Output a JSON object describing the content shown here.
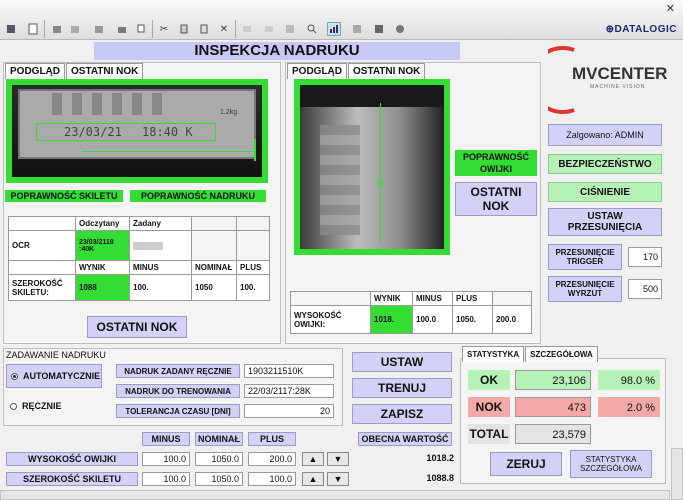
{
  "toolbar": {
    "brand": "DATALOGIC",
    "close_glyph": "✕",
    "icons": [
      "stop-icon",
      "document-icon",
      "save-icon",
      "open-icon",
      "folder-icon",
      "print-icon",
      "cut-icon",
      "copy-icon",
      "paste-icon",
      "delete-icon",
      "undo-icon",
      "redo-icon",
      "zoom-icon",
      "chart-icon",
      "find-icon",
      "stop-square-icon",
      "record-icon"
    ]
  },
  "title": "INSPEKCJA NADRUKU",
  "logo": {
    "text": "MVCENTER",
    "subtitle": "MACHINE VISION"
  },
  "left_panel": {
    "tabs": [
      "PODGLĄD",
      "OSTATNI NOK"
    ],
    "camera_text_1": "23/03/21",
    "camera_text_2": "18:40 K",
    "camera_corner": "1.2kg",
    "status_skeleton": "POPRAWNOŚĆ SKILETU",
    "status_print": "POPRAWNOŚĆ NADRUKU",
    "ocr_table": {
      "header": [
        "",
        "Odczytany",
        "Zadany"
      ],
      "ocr_label": "OCR",
      "ocr_read": "23/03/2118 :40K",
      "width_header": [
        "",
        "WYNIK",
        "MINUS",
        "NOMINAŁ",
        "PLUS"
      ],
      "width_label": "SZEROKOŚĆ SKILETU:",
      "width_values": [
        "1088",
        "100.",
        "1050",
        "100."
      ]
    },
    "last_nok_button": "OSTATNI NOK"
  },
  "mid_panel": {
    "tabs": [
      "PODGLĄD",
      "OSTATNI NOK"
    ],
    "status_wrap": "POPRAWNOŚĆ OWIJKI",
    "last_nok_button": "OSTATNI NOK",
    "height_table": {
      "header": [
        "",
        "WYNIK",
        "MINUS",
        "PLUS",
        ""
      ],
      "label": "WYSOKOŚĆ OWIJKI:",
      "values": [
        "1018.",
        "100.0",
        "1050.",
        "200.0"
      ]
    }
  },
  "right_panel": {
    "logged": "Zalgowano: ADMIN",
    "security": "BEZPIECZEŃSTWO",
    "pressure": "CIŚNIENIE",
    "set_delay": "USTAW PRZESUNIĘCIA",
    "trigger_label": "PRZESUNIĘCIE TRIGGER",
    "trigger_value": "170",
    "eject_label": "PRZESUNIĘCIE WYRZUT",
    "eject_value": "500"
  },
  "print_setup": {
    "title": "ZADAWANIE NADRUKU",
    "auto": "AUTOMATYCZNIE",
    "manual": "RĘCZNIE",
    "manual_label": "NADRUK ZADANY RĘCZNIE",
    "manual_value": "1903211510K",
    "train_label": "NADRUK DO TRENOWANIA",
    "train_value": "22/03/2117:28K",
    "tol_label": "TOLERANCJA CZASU [DNI]",
    "tol_value": "20"
  },
  "actions": {
    "set": "USTAW",
    "train": "TRENUJ",
    "save": "ZAPISZ"
  },
  "params": {
    "cols": [
      "MINUS",
      "NOMINAŁ",
      "PLUS"
    ],
    "current_header": "OBECNA WARTOŚĆ",
    "rows": [
      {
        "label": "WYSOKOŚĆ OWIJKI",
        "minus": "100.0",
        "nominal": "1050.0",
        "plus": "200.0",
        "current": "1018.2"
      },
      {
        "label": "SZEROKOŚĆ SKILETU",
        "minus": "100.0",
        "nominal": "1050.0",
        "plus": "100.0",
        "current": "1088.8"
      }
    ]
  },
  "stats": {
    "tabs": [
      "STATYSTYKA",
      "SZCZEGÓŁOWA"
    ],
    "ok_label": "OK",
    "ok_count": "23,106",
    "ok_pct": "98.0 %",
    "nok_label": "NOK",
    "nok_count": "473",
    "nok_pct": "2.0 %",
    "total_label": "TOTAL",
    "total_count": "23,579",
    "reset": "ZERUJ",
    "detail": "STATYSTYKA SZCZEGÓŁOWA"
  },
  "colors": {
    "green": "#33dd33",
    "lavender": "#d2d2f8",
    "ok_bg": "#b6f2b6",
    "nok_bg": "#f5a8a8"
  }
}
